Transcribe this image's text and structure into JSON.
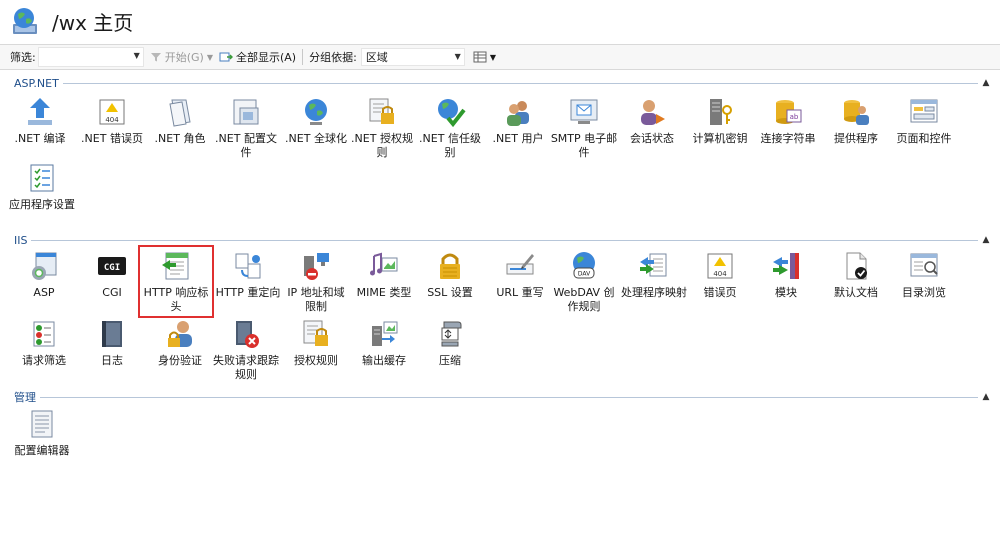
{
  "header": {
    "title": "/wx 主页"
  },
  "toolbar": {
    "filter_label": "筛选:",
    "start_label": "开始(G)",
    "show_all_label": "全部显示(A)",
    "group_label": "分组依据:",
    "group_value": "区域"
  },
  "sections": {
    "aspnet": {
      "title": "ASP.NET",
      "items": [
        ".NET 编译",
        ".NET 错误页",
        ".NET 角色",
        ".NET 配置文件",
        ".NET 全球化",
        ".NET 授权规则",
        ".NET 信任级别",
        ".NET 用户",
        "SMTP 电子邮件",
        "会话状态",
        "计算机密钥",
        "连接字符串",
        "提供程序",
        "页面和控件",
        "应用程序设置"
      ]
    },
    "iis": {
      "title": "IIS",
      "items": [
        "ASP",
        "CGI",
        "HTTP 响应标头",
        "HTTP 重定向",
        "IP 地址和域限制",
        "MIME 类型",
        "SSL 设置",
        "URL 重写",
        "WebDAV 创作规则",
        "处理程序映射",
        "错误页",
        "模块",
        "默认文档",
        "目录浏览",
        "请求筛选",
        "日志",
        "身份验证",
        "失败请求跟踪规则",
        "授权规则",
        "输出缓存",
        "压缩"
      ]
    },
    "management": {
      "title": "管理",
      "items": [
        "配置编辑器"
      ]
    }
  },
  "icon_text": {
    "cgi": "CGI",
    "err404": "404",
    "dav": "DAV",
    "ab": "ab"
  }
}
